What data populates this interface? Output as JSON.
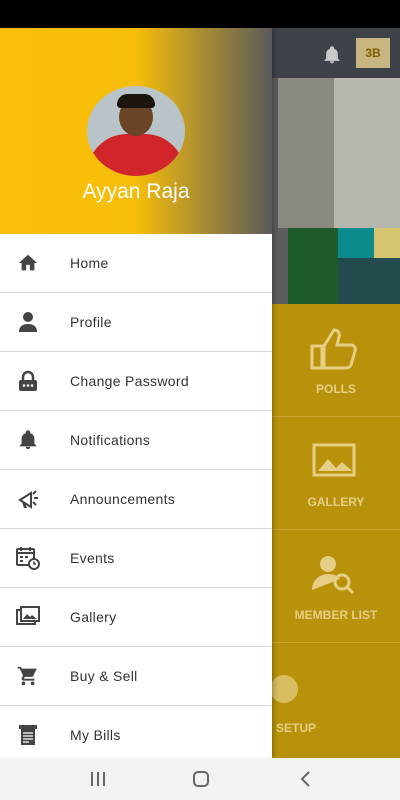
{
  "drawer": {
    "user_name": "Ayyan Raja",
    "menu": [
      {
        "label": "Home",
        "icon": "home-icon"
      },
      {
        "label": "Profile",
        "icon": "person-icon"
      },
      {
        "label": "Change Password",
        "icon": "lock-icon"
      },
      {
        "label": "Notifications",
        "icon": "bell-icon"
      },
      {
        "label": "Announcements",
        "icon": "megaphone-icon"
      },
      {
        "label": "Events",
        "icon": "calendar-clock-icon"
      },
      {
        "label": "Gallery",
        "icon": "photos-icon"
      },
      {
        "label": "Buy & Sell",
        "icon": "cart-icon"
      },
      {
        "label": "My Bills",
        "icon": "bill-icon"
      }
    ]
  },
  "background": {
    "badge": "3B",
    "tiles": [
      "POLLS",
      "GALLERY",
      "MEMBER LIST",
      "SETUP"
    ]
  },
  "colors": {
    "header_yellow": "#fbbf09",
    "tile_gold": "#b8920a",
    "topbar": "#3d4249"
  }
}
